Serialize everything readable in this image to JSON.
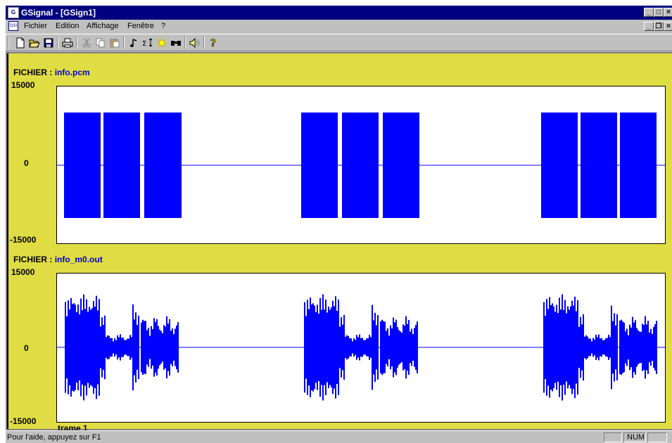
{
  "window": {
    "title": "GSignal - [GSign1]",
    "app_icon_text": "G",
    "min_symbol": "_",
    "max_symbol": "□",
    "close_symbol": "×",
    "restore_symbol": "❐"
  },
  "menu": {
    "items": [
      "Fichier",
      "Edition",
      "Affichage",
      "Fenêtre",
      "?"
    ]
  },
  "toolbar": {
    "buttons": [
      "new-icon",
      "open-icon",
      "save-icon",
      "print-icon",
      "cut-icon",
      "copy-icon",
      "paste-icon",
      "note-icon",
      "sum-icon",
      "sun-icon",
      "binoculars-icon",
      "speaker-icon",
      "help-icon"
    ]
  },
  "plots": [
    {
      "file_label": "FICHIER :",
      "file_name": "info.pcm",
      "y_max": "15000",
      "y_zero": "0",
      "y_min": "-15000"
    },
    {
      "file_label": "FICHIER :",
      "file_name": "info_m0.out",
      "y_max": "15000",
      "y_zero": "0",
      "y_min": "-15000"
    }
  ],
  "frame_label": "trame 1",
  "status": {
    "help_text": "Pour l'aide, appuyez sur F1",
    "num": "NUM"
  },
  "colors": {
    "title_bar": "#000080",
    "doc_background": "#e0dc44",
    "signal": "#0000ff"
  }
}
